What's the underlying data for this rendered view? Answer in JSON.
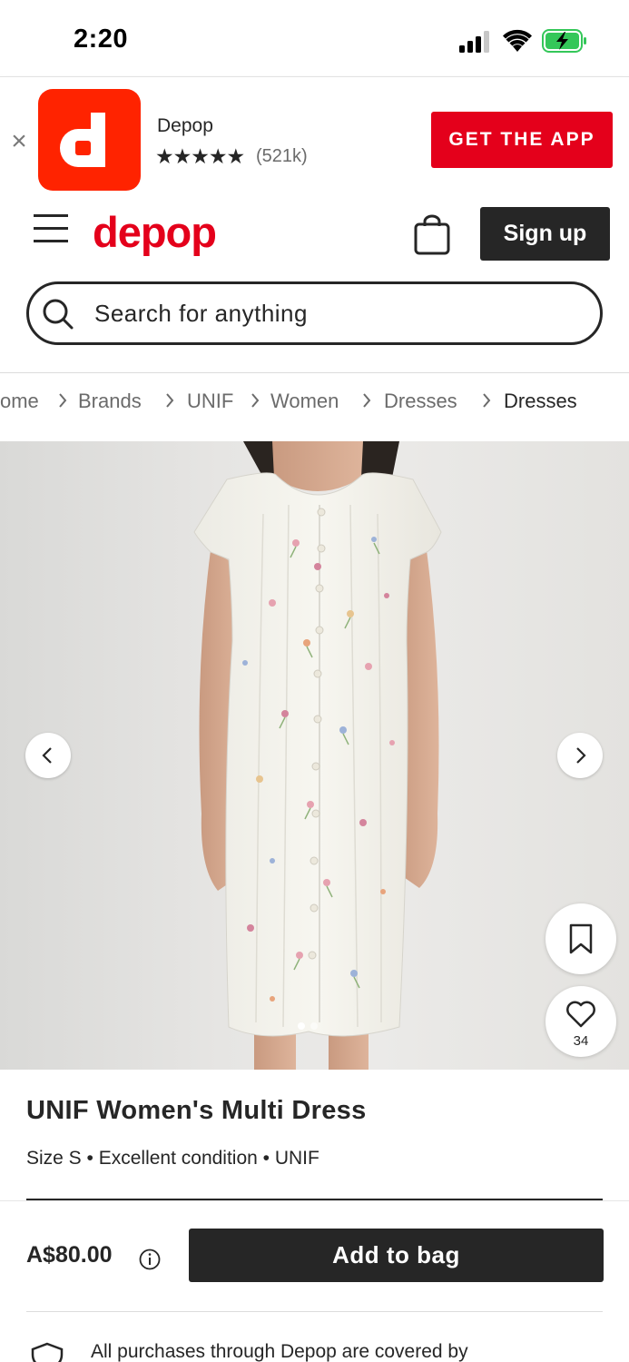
{
  "status_bar": {
    "time": "2:20"
  },
  "app_banner": {
    "close_symbol": "×",
    "app_name": "Depop",
    "stars": "★★★★★",
    "rating_count": "(521k)",
    "cta_label": "GET THE APP",
    "brand_color": "#e4001b"
  },
  "header": {
    "logo_text": "depop",
    "signup_label": "Sign up"
  },
  "search": {
    "placeholder": "Search for anything"
  },
  "breadcrumb": {
    "items": [
      "ome",
      "Brands",
      "UNIF",
      "Women",
      "Dresses",
      "Dresses"
    ]
  },
  "gallery": {
    "like_count": "34",
    "current_image": 1,
    "image_count": 2
  },
  "product": {
    "title": "UNIF Women's Multi Dress",
    "meta": "Size S • Excellent condition • UNIF"
  },
  "buy_bar": {
    "price": "A$80.00",
    "add_to_bag_label": "Add to bag",
    "protection_text": "All purchases through Depop are covered by"
  },
  "icons": [
    "signal-icon",
    "wifi-icon",
    "battery-icon",
    "close-icon",
    "menu-icon",
    "bag-icon",
    "search-icon",
    "chevron-left-icon",
    "chevron-right-icon",
    "bookmark-icon",
    "heart-icon",
    "info-icon",
    "shield-icon"
  ]
}
